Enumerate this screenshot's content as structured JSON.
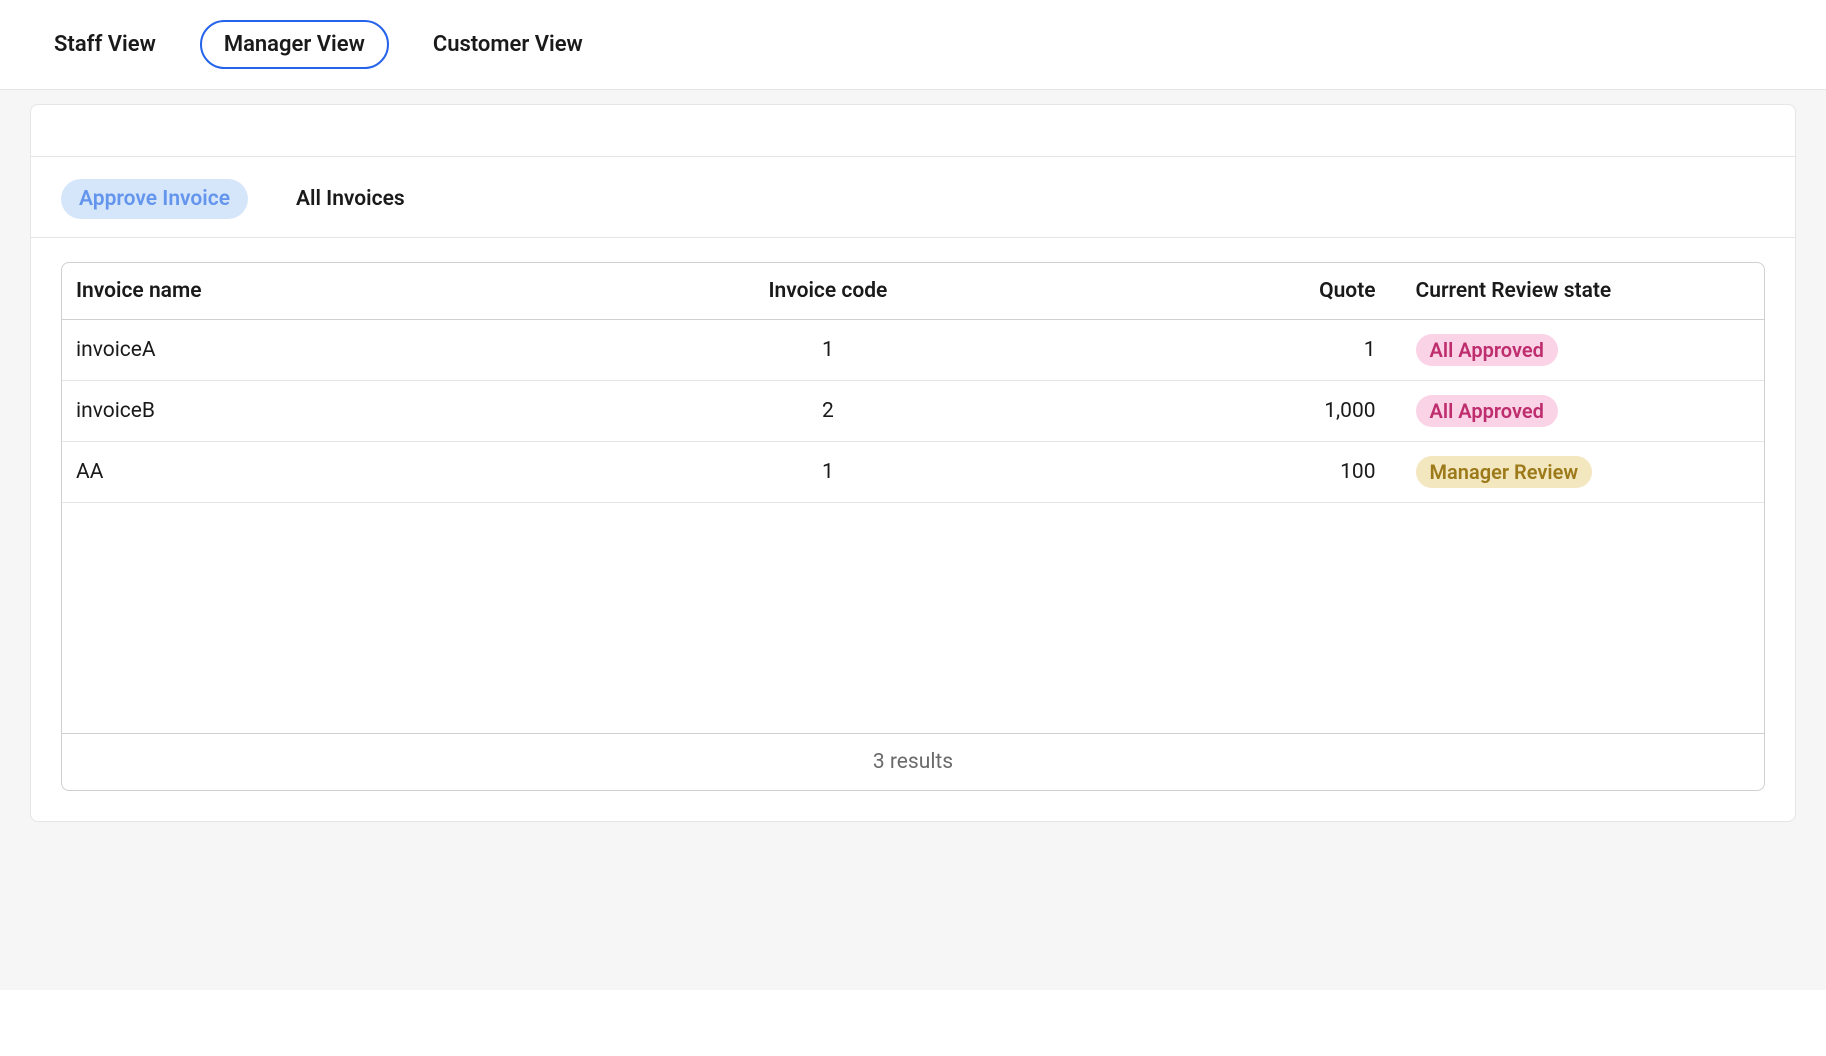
{
  "nav": {
    "tabs": [
      {
        "label": "Staff View",
        "active": false
      },
      {
        "label": "Manager View",
        "active": true
      },
      {
        "label": "Customer View",
        "active": false
      }
    ]
  },
  "subTabs": [
    {
      "label": "Approve Invoice",
      "active": true
    },
    {
      "label": "All Invoices",
      "active": false
    }
  ],
  "table": {
    "columns": {
      "name": "Invoice name",
      "code": "Invoice code",
      "quote": "Quote",
      "state": "Current Review state"
    },
    "rows": [
      {
        "name": "invoiceA",
        "code": "1",
        "quote": "1",
        "state": "All Approved",
        "stateKind": "approved"
      },
      {
        "name": "invoiceB",
        "code": "2",
        "quote": "1,000",
        "state": "All Approved",
        "stateKind": "approved"
      },
      {
        "name": "AA",
        "code": "1",
        "quote": "100",
        "state": "Manager Review",
        "stateKind": "manager"
      }
    ],
    "footer": "3 results"
  }
}
